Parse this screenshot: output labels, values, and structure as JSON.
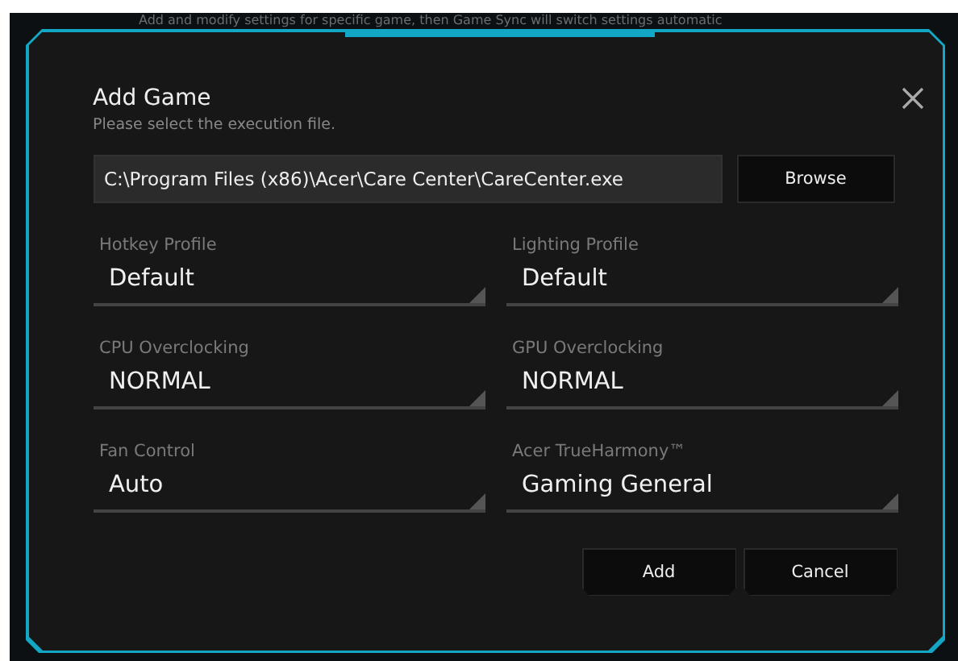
{
  "background_text": "Add and modify settings for specific game, then Game Sync will switch settings automatic",
  "dialog": {
    "title": "Add Game",
    "subtitle": "Please select the execution file.",
    "file_path": "C:\\Program Files (x86)\\Acer\\Care Center\\CareCenter.exe",
    "browse_button": "Browse",
    "fields": [
      {
        "label": "Hotkey Profile",
        "value": "Default"
      },
      {
        "label": "Lighting Profile",
        "value": "Default"
      },
      {
        "label": "CPU Overclocking",
        "value": "NORMAL"
      },
      {
        "label": "GPU Overclocking",
        "value": "NORMAL"
      },
      {
        "label": "Fan Control",
        "value": "Auto"
      },
      {
        "label": "Acer TrueHarmony™",
        "value": "Gaming General"
      }
    ],
    "buttons": [
      "Add",
      "Cancel"
    ]
  }
}
